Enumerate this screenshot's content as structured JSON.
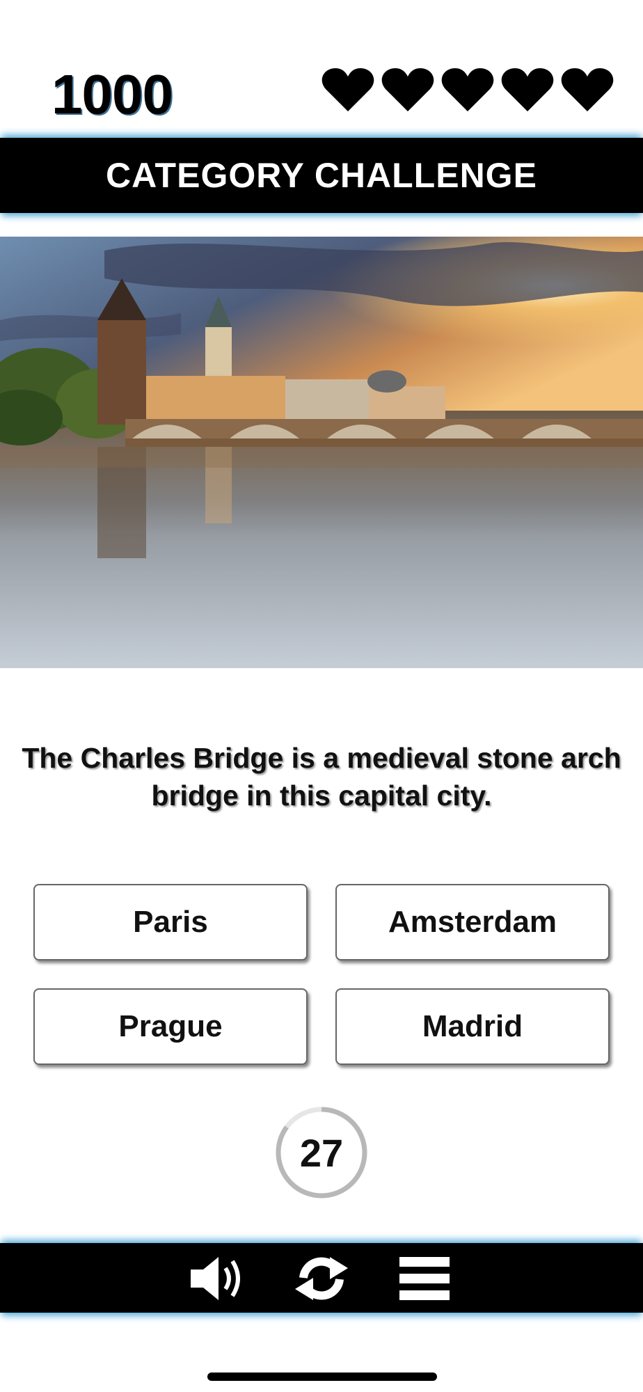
{
  "header": {
    "score": "1000",
    "lives": [
      true,
      true,
      true,
      true,
      true
    ],
    "title": "CATEGORY CHALLENGE"
  },
  "image": {
    "icon": "charles-bridge-prague-photo"
  },
  "question": {
    "text": "The Charles Bridge is a medieval stone arch bridge in this capital city."
  },
  "answers": [
    "Paris",
    "Amsterdam",
    "Prague",
    "Madrid"
  ],
  "timer": {
    "seconds": "27",
    "remaining_fraction": 0.85
  },
  "controls": {
    "icons": [
      "speaker-icon",
      "refresh-icon",
      "menu-icon"
    ]
  },
  "colors": {
    "accent_glow": "#4ea8d8",
    "bar": "#000000"
  }
}
